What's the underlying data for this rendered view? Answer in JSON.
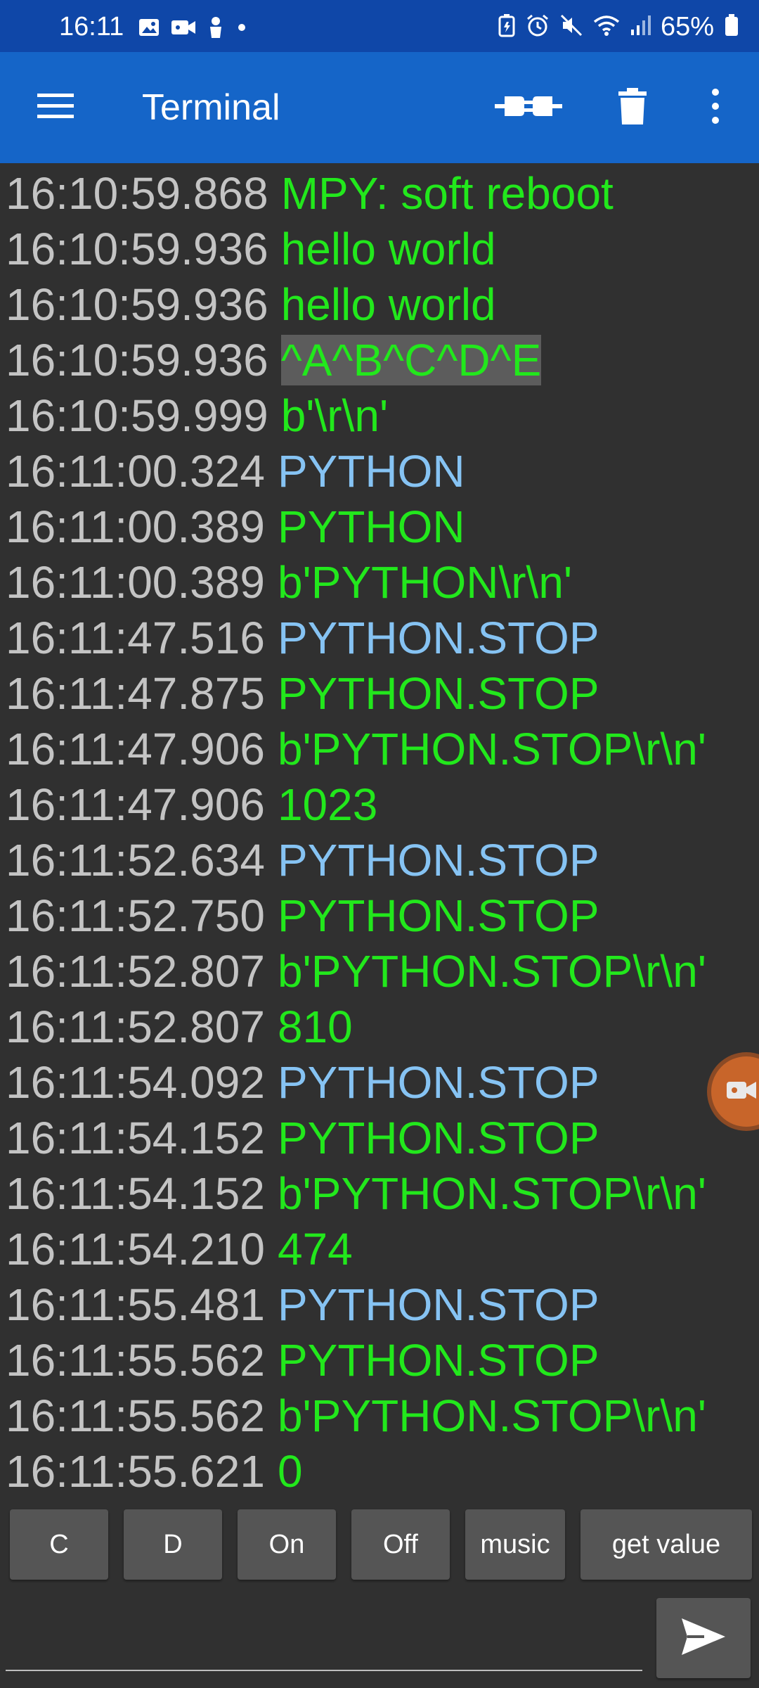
{
  "status_bar": {
    "time": "16:11",
    "battery": "65%",
    "left_icons": [
      "gallery-icon",
      "video-icon",
      "location-person-icon",
      "dot-icon"
    ],
    "right_icons": [
      "battery-saver-icon",
      "alarm-icon",
      "mute-icon",
      "wifi-icon",
      "signal-icon"
    ]
  },
  "app_bar": {
    "title": "Terminal",
    "icons": [
      "menu-icon",
      "connect-plug-icon",
      "delete-icon",
      "more-vertical-icon"
    ],
    "background": "#1565c8"
  },
  "terminal": {
    "colors": {
      "timestamp": "#c4c4c4",
      "received": "#22e81c",
      "sent": "#86c3f3",
      "selection": "#5c5c5c"
    },
    "lines": [
      {
        "time": "16:10:59.868",
        "text": "MPY: soft reboot",
        "dir": "rx"
      },
      {
        "time": "16:10:59.936",
        "text": "hello world",
        "dir": "rx"
      },
      {
        "time": "16:10:59.936",
        "text": "hello world",
        "dir": "rx"
      },
      {
        "time": "16:10:59.936",
        "text": "^A^B^C^D^E",
        "dir": "rx",
        "selected": true
      },
      {
        "time": "16:10:59.999",
        "text": "b'\\r\\n'",
        "dir": "rx"
      },
      {
        "time": "16:11:00.324",
        "text": "PYTHON",
        "dir": "tx"
      },
      {
        "time": "16:11:00.389",
        "text": "PYTHON",
        "dir": "rx"
      },
      {
        "time": "16:11:00.389",
        "text": "b'PYTHON\\r\\n'",
        "dir": "rx"
      },
      {
        "time": "16:11:47.516",
        "text": "PYTHON.STOP",
        "dir": "tx"
      },
      {
        "time": "16:11:47.875",
        "text": "PYTHON.STOP",
        "dir": "rx"
      },
      {
        "time": "16:11:47.906",
        "text": "b'PYTHON.STOP\\r\\n'",
        "dir": "rx"
      },
      {
        "time": "16:11:47.906",
        "text": "1023",
        "dir": "rx"
      },
      {
        "time": "16:11:52.634",
        "text": "PYTHON.STOP",
        "dir": "tx"
      },
      {
        "time": "16:11:52.750",
        "text": "PYTHON.STOP",
        "dir": "rx"
      },
      {
        "time": "16:11:52.807",
        "text": "b'PYTHON.STOP\\r\\n'",
        "dir": "rx"
      },
      {
        "time": "16:11:52.807",
        "text": "810",
        "dir": "rx"
      },
      {
        "time": "16:11:54.092",
        "text": "PYTHON.STOP",
        "dir": "tx"
      },
      {
        "time": "16:11:54.152",
        "text": "PYTHON.STOP",
        "dir": "rx"
      },
      {
        "time": "16:11:54.152",
        "text": "b'PYTHON.STOP\\r\\n'",
        "dir": "rx"
      },
      {
        "time": "16:11:54.210",
        "text": "474",
        "dir": "rx"
      },
      {
        "time": "16:11:55.481",
        "text": "PYTHON.STOP",
        "dir": "tx"
      },
      {
        "time": "16:11:55.562",
        "text": "PYTHON.STOP",
        "dir": "rx"
      },
      {
        "time": "16:11:55.562",
        "text": "b'PYTHON.STOP\\r\\n'",
        "dir": "rx"
      },
      {
        "time": "16:11:55.621",
        "text": "0",
        "dir": "rx"
      }
    ]
  },
  "floating": {
    "icon": "video-camera-icon",
    "color": "#c8652a"
  },
  "macros": [
    {
      "label": "C"
    },
    {
      "label": "D"
    },
    {
      "label": "On"
    },
    {
      "label": "Off"
    },
    {
      "label": "music"
    },
    {
      "label": "get value"
    }
  ],
  "input": {
    "value": "",
    "placeholder": "",
    "send_icon": "send-icon"
  }
}
